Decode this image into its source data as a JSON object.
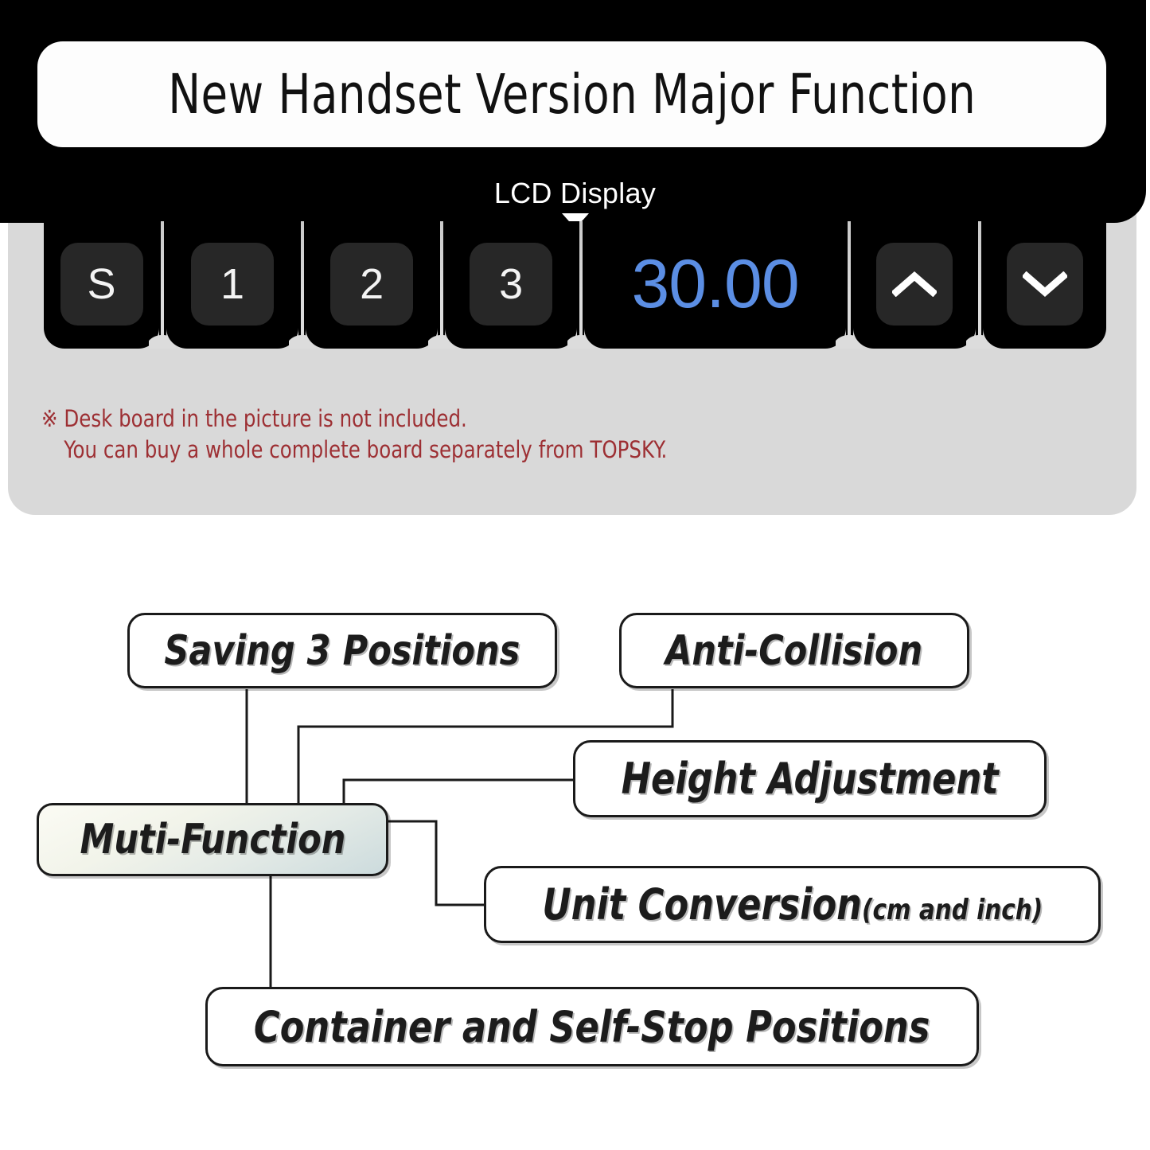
{
  "header": {
    "title": "New Handset Version Major Function"
  },
  "handset": {
    "lcd_label": "LCD Display",
    "lcd_pointer_icon": "triangle-down-icon",
    "lcd_value": "30.00",
    "lcd_color": "#5b8ee4",
    "keys": [
      {
        "id": "s",
        "label": "S",
        "name": "key-s"
      },
      {
        "id": "one",
        "label": "1",
        "name": "key-1"
      },
      {
        "id": "two",
        "label": "2",
        "name": "key-2"
      },
      {
        "id": "three",
        "label": "3",
        "name": "key-3"
      },
      {
        "id": "up",
        "label": "",
        "name": "key-up",
        "icon": "chevron-up-icon"
      },
      {
        "id": "down",
        "label": "",
        "name": "key-down",
        "icon": "chevron-down-icon"
      }
    ]
  },
  "disclaimer": {
    "marker": "※",
    "line1": "Desk board in the picture is not included.",
    "line2": "You can buy a whole complete board separately from TOPSKY.",
    "color": "#9d2f33"
  },
  "diagram": {
    "root": "Muti-Function",
    "nodes": {
      "saving": "Saving 3 Positions",
      "anti_collision": "Anti-Collision",
      "height_adjustment": "Height Adjustment",
      "unit_conversion_main": "Unit Conversion",
      "unit_conversion_sub": "(cm and inch)",
      "container": "Container and Self-Stop Positions"
    }
  }
}
